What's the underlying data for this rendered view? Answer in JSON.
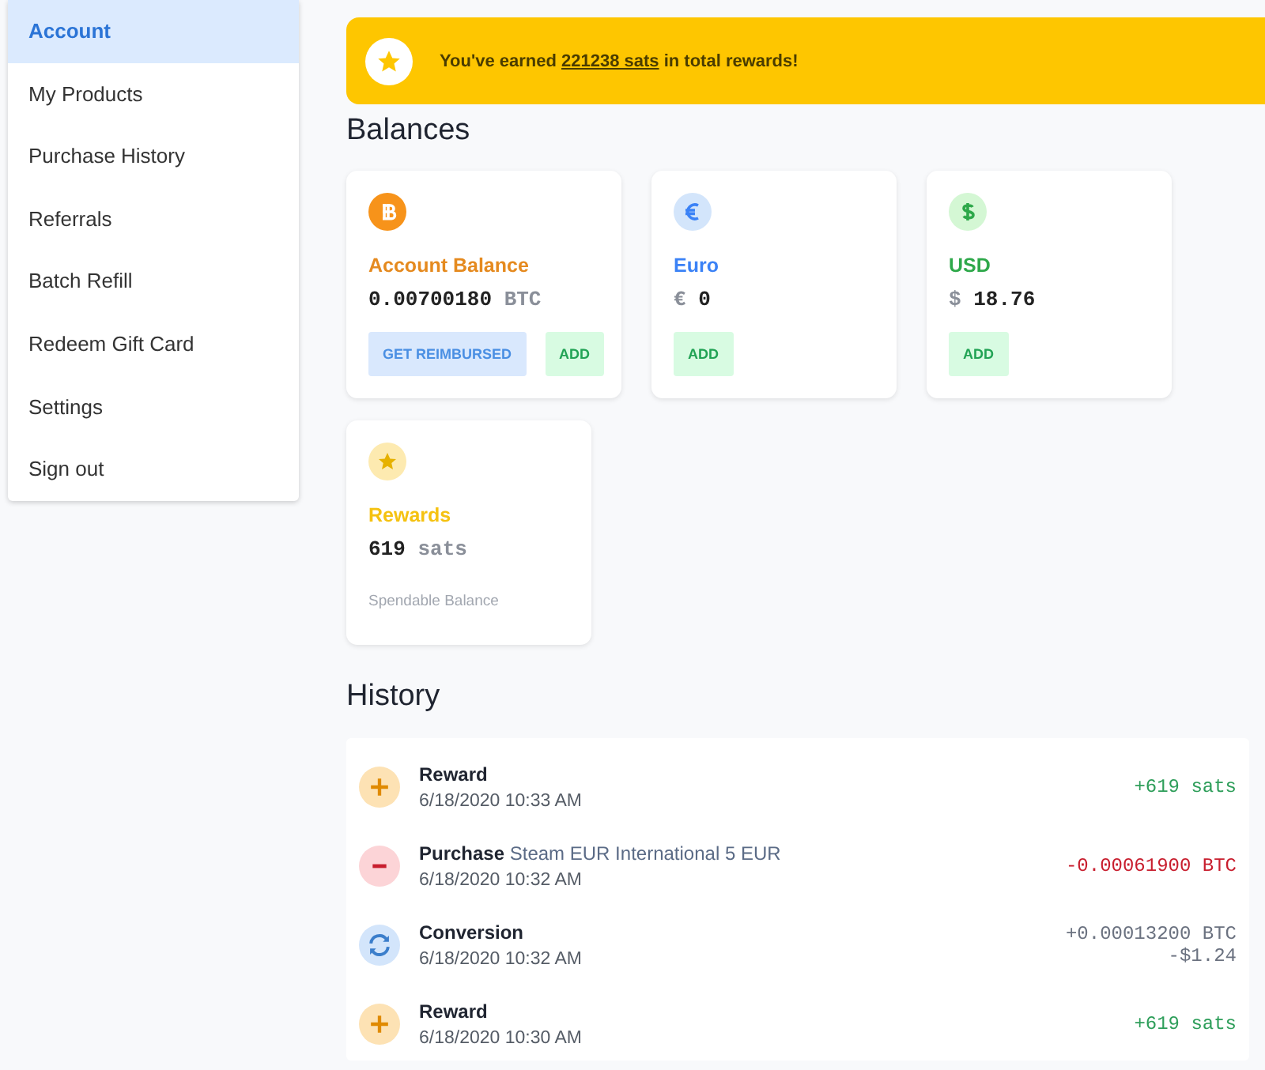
{
  "sidebar": {
    "items": [
      {
        "label": "Account",
        "selected": true
      },
      {
        "label": "My Products",
        "selected": false
      },
      {
        "label": "Purchase History",
        "selected": false
      },
      {
        "label": "Referrals",
        "selected": false
      },
      {
        "label": "Batch Refill",
        "selected": false
      },
      {
        "label": "Redeem Gift Card",
        "selected": false
      },
      {
        "label": "Settings",
        "selected": false
      },
      {
        "label": "Sign out",
        "selected": false
      }
    ]
  },
  "banner": {
    "before": "You've earned",
    "link": "221238 sats",
    "after": "in total rewards!"
  },
  "balances": {
    "title": "Balances",
    "cards": [
      {
        "kind": "btc",
        "label": "Account Balance",
        "amount": "0.00700180",
        "unit": "BTC",
        "buttons": [
          {
            "kind": "reimburse",
            "label": "GET REIMBURSED"
          },
          {
            "kind": "add",
            "label": "ADD"
          }
        ]
      },
      {
        "kind": "eur",
        "label": "Euro",
        "amount": "0",
        "unit": "€",
        "buttons": [
          {
            "kind": "add",
            "label": "ADD"
          }
        ]
      },
      {
        "kind": "usd",
        "label": "USD",
        "amount": "18.76",
        "unit": "$",
        "buttons": [
          {
            "kind": "add",
            "label": "ADD"
          }
        ]
      },
      {
        "kind": "rewards",
        "label": "Rewards",
        "amount": "619",
        "unit": "sats",
        "note": "Spendable Balance"
      }
    ]
  },
  "history": {
    "title": "History",
    "rows": [
      {
        "kind": "reward",
        "title": "Reward",
        "time": "6/18/2020 10:33 AM",
        "amounts": [
          "+619 sats"
        ]
      },
      {
        "kind": "purchase",
        "title": "Purchase",
        "detail": "Steam EUR International 5 EUR",
        "time": "6/18/2020 10:32 AM",
        "amounts": [
          "-0.00061900 BTC"
        ]
      },
      {
        "kind": "conversion",
        "title": "Conversion",
        "time": "6/18/2020 10:32 AM",
        "amounts": [
          "+0.00013200 BTC",
          "-$1.24"
        ]
      },
      {
        "kind": "reward",
        "title": "Reward",
        "time": "6/18/2020 10:30 AM",
        "amounts": [
          "+619 sats"
        ]
      }
    ]
  }
}
